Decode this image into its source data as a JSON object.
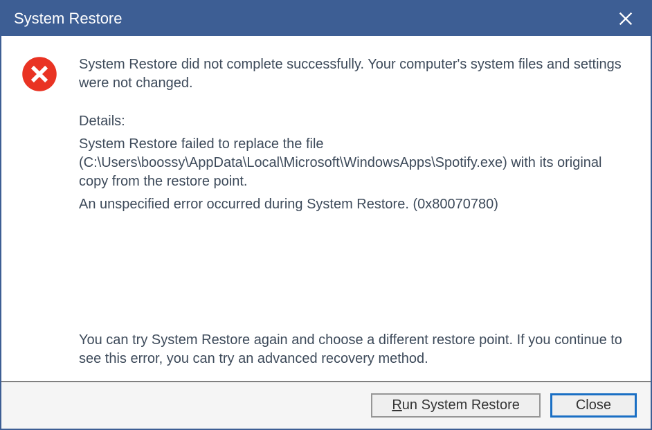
{
  "window": {
    "title": "System Restore"
  },
  "dialog": {
    "summary": "System Restore did not complete successfully. Your computer's system files and settings were not changed.",
    "details_label": "Details:",
    "details_line1": "System Restore failed to replace the file (C:\\Users\\boossy\\AppData\\Local\\Microsoft\\WindowsApps\\Spotify.exe) with its original copy from the restore point.",
    "details_line2": "An unspecified error occurred during System Restore. (0x80070780)",
    "suggestion": "You can try System Restore again and choose a different restore point. If you continue to see this error, you can try an advanced recovery method."
  },
  "buttons": {
    "run_prefix": "R",
    "run_suffix": "un System Restore",
    "close": "Close"
  },
  "colors": {
    "titlebar": "#3d5e94",
    "error": "#e93323"
  }
}
